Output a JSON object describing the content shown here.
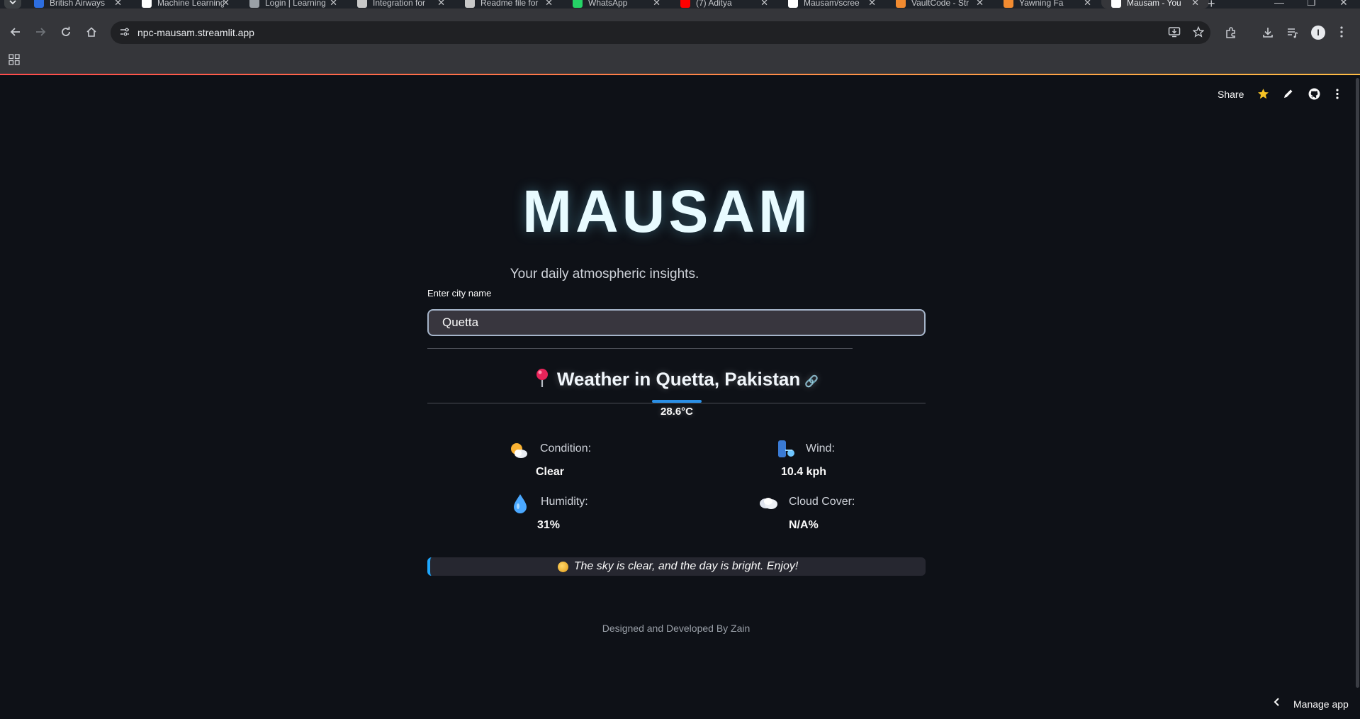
{
  "browser": {
    "tabs": [
      {
        "title": "British Airways",
        "favicon_color": "#2d6ee0"
      },
      {
        "title": "Machine Learning",
        "favicon_color": "#ffffff"
      },
      {
        "title": "Login | Learning",
        "favicon_color": "#9aa0a6"
      },
      {
        "title": "Integration for",
        "favicon_color": "#c8c8c8"
      },
      {
        "title": "Readme file for",
        "favicon_color": "#c8c8c8"
      },
      {
        "title": "WhatsApp",
        "favicon_color": "#25d366"
      },
      {
        "title": "(7) Aditya",
        "favicon_color": "#ff0000"
      },
      {
        "title": "Mausam/scree",
        "favicon_color": "#ffffff"
      },
      {
        "title": "VaultCode - Str",
        "favicon_color": "#f28b30"
      },
      {
        "title": "Yawning Fa",
        "favicon_color": "#f28b30"
      },
      {
        "title": "Mausam - You",
        "favicon_color": "#ffffff",
        "active": true
      }
    ],
    "url": "npc-mausam.streamlit.app"
  },
  "streamlit_header": {
    "share_label": "Share",
    "manage_app_label": "Manage app"
  },
  "app": {
    "title": "MAUSAM",
    "subtitle": "Your daily atmospheric insights.",
    "input_label": "Enter city name",
    "input_value": "Quetta",
    "weather_heading": "Weather in Quetta, Pakistan",
    "temperature": "28.6°C",
    "metrics": {
      "condition": {
        "label": "Condition:",
        "value": "Clear"
      },
      "wind": {
        "label": "Wind:",
        "value": "10.4 kph"
      },
      "humidity": {
        "label": "Humidity:",
        "value": "31%"
      },
      "cloud_cover": {
        "label": "Cloud Cover:",
        "value": "N/A%"
      }
    },
    "message": "The sky is clear, and the day is bright. Enjoy!",
    "footer": "Designed and Developed By Zain"
  },
  "colors": {
    "background": "#0e1117",
    "accent_gradient_start": "#ff4b4b",
    "accent_gradient_end": "#ffbd45",
    "info_border": "#1ea7fd",
    "temp_bar": "#2a8fe6"
  }
}
